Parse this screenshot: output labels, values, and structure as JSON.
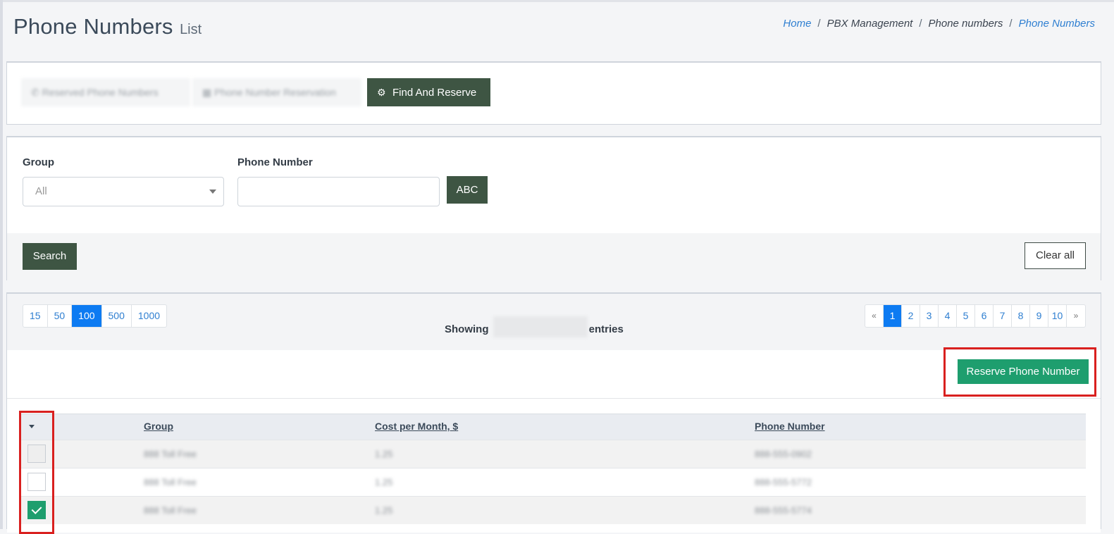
{
  "header": {
    "title": "Phone Numbers",
    "subtitle": "List",
    "breadcrumb": [
      "Home",
      "PBX Management",
      "Phone numbers",
      "Phone Numbers"
    ]
  },
  "tabs": {
    "items": [
      {
        "label": "Reserved Phone Numbers",
        "state": "blurred"
      },
      {
        "label": "Phone Number Reservation",
        "state": "blurred"
      },
      {
        "label": "Find And Reserve",
        "state": "active",
        "icon": "gears-icon"
      }
    ]
  },
  "filter": {
    "group_label": "Group",
    "group_value": "All",
    "phone_label": "Phone Number",
    "phone_value": "",
    "abc_button": "ABC",
    "search_button": "Search",
    "clear_button": "Clear all"
  },
  "listing": {
    "page_sizes": [
      "15",
      "50",
      "100",
      "500",
      "1000"
    ],
    "active_page_size": "100",
    "showing_prefix": "Showing",
    "showing_suffix": "entries",
    "pages": [
      "«",
      "1",
      "2",
      "3",
      "4",
      "5",
      "6",
      "7",
      "8",
      "9",
      "10",
      "»"
    ],
    "active_page": "1",
    "reserve_button": "Reserve Phone Number"
  },
  "table": {
    "columns": [
      "Group",
      "Cost per Month, $",
      "Phone Number"
    ],
    "rows": [
      {
        "group": "888 Toll Free",
        "cost": "1.25",
        "phone": "888-555-0902",
        "checkbox": "disabled"
      },
      {
        "group": "888 Toll Free",
        "cost": "1.25",
        "phone": "888-555-5772",
        "checkbox": "unchecked"
      },
      {
        "group": "888 Toll Free",
        "cost": "1.25",
        "phone": "888-555-5774",
        "checkbox": "checked"
      }
    ]
  },
  "colors": {
    "primary_dark": "#3e5543",
    "accent_green": "#1e9e6e",
    "link_blue": "#2f7fd1",
    "active_page_blue": "#0d7bf2",
    "highlight_red": "#d9201f"
  }
}
